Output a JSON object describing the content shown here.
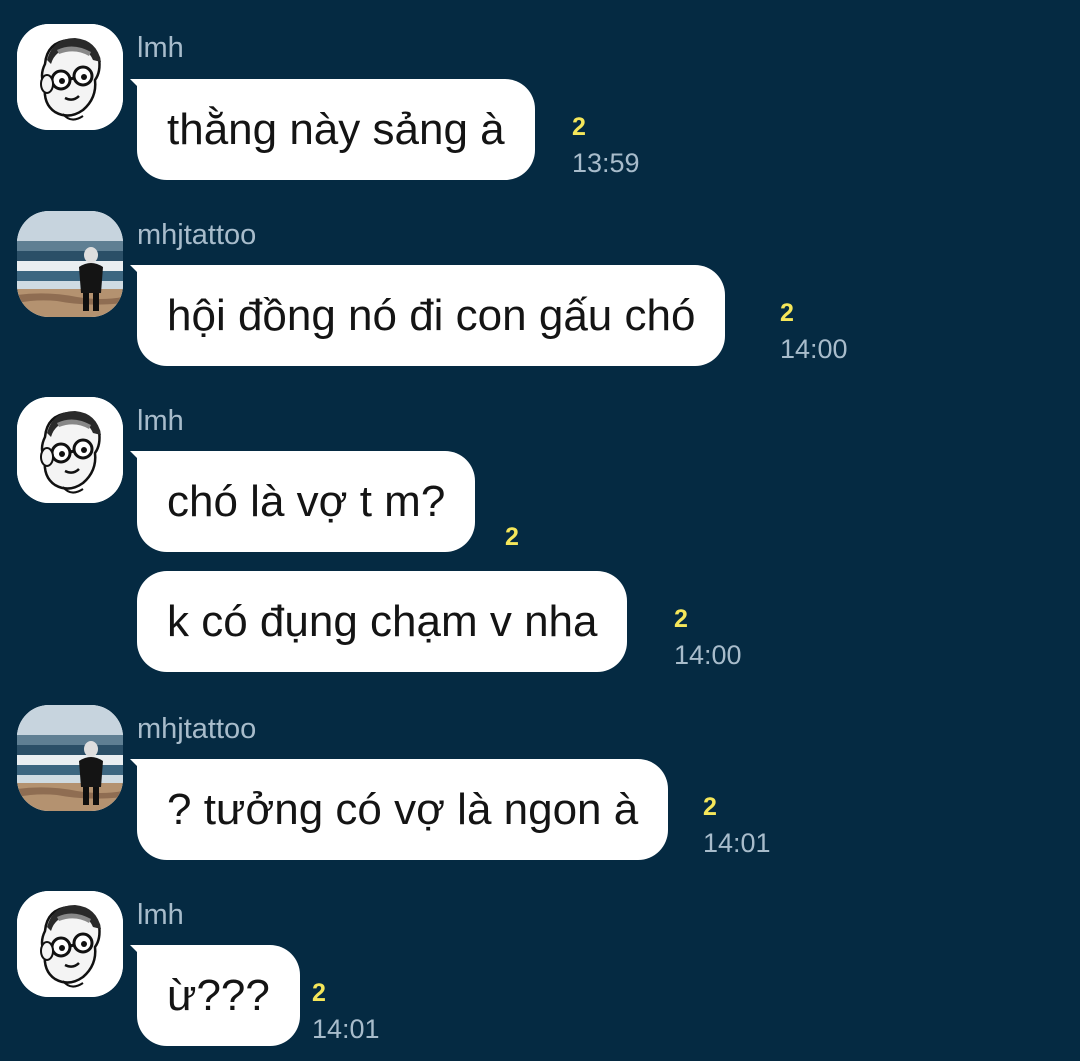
{
  "colors": {
    "background": "#052a42",
    "bubble": "#ffffff",
    "sender_name": "#a8bccb",
    "unread_count": "#f5e65a"
  },
  "messages": [
    {
      "sender": "lmh",
      "avatar": "cartoon-avatar",
      "text": "thằng này sảng à",
      "unread": "2",
      "time": "13:59"
    },
    {
      "sender": "mhjtattoo",
      "avatar": "beach-photo-avatar",
      "text": "hội đồng nó đi con gấu chó",
      "unread": "2",
      "time": "14:00"
    },
    {
      "sender": "lmh",
      "avatar": "cartoon-avatar",
      "text": "chó là vợ t m?",
      "unread": "2",
      "time": ""
    },
    {
      "sender": "",
      "avatar": "",
      "text": "k có đụng chạm v nha",
      "unread": "2",
      "time": "14:00"
    },
    {
      "sender": "mhjtattoo",
      "avatar": "beach-photo-avatar",
      "text": "? tưởng có vợ là ngon à",
      "unread": "2",
      "time": "14:01"
    },
    {
      "sender": "lmh",
      "avatar": "cartoon-avatar",
      "text": "ừ???",
      "unread": "2",
      "time": "14:01"
    }
  ]
}
